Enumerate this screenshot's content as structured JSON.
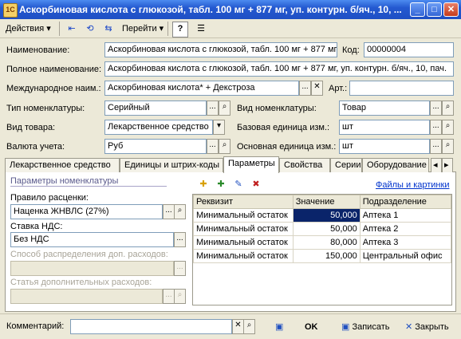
{
  "window": {
    "title": "Аскорбиновая кислота с глюкозой, табл. 100 мг + 877 мг, уп. контурн. б/яч., 10, ..."
  },
  "toolbar": {
    "actions_label": "Действия",
    "goto_label": "Перейти"
  },
  "form": {
    "name_label": "Наименование:",
    "name_value": "Аскорбиновая кислота с глюкозой, табл. 100 мг + 877 мг",
    "code_label": "Код:",
    "code_value": "00000004",
    "fullname_label": "Полное наименование:",
    "fullname_value": "Аскорбиновая кислота с глюкозой, табл. 100 мг + 877 мг, уп. контурн. б/яч., 10, пач.",
    "intl_label": "Международное наим.:",
    "intl_value": "Аскорбиновая кислота* + Декстроза",
    "art_label": "Арт.:",
    "art_value": "",
    "nom_type_label": "Тип номенклатуры:",
    "nom_type_value": "Серийный",
    "nom_kind_label": "Вид номенклатуры:",
    "nom_kind_value": "Товар",
    "goods_kind_label": "Вид товара:",
    "goods_kind_value": "Лекарственное средство",
    "base_unit_label": "Базовая единица изм.:",
    "base_unit_value": "шт",
    "currency_label": "Валюта учета:",
    "currency_value": "Руб",
    "main_unit_label": "Основная единица изм.:",
    "main_unit_value": "шт"
  },
  "tabs": [
    "Лекарственное средство",
    "Единицы и штрих-коды",
    "Параметры",
    "Свойства",
    "Серии",
    "Оборудование"
  ],
  "params": {
    "section_title": "Параметры номенклатуры",
    "pricing_rule_label": "Правило расценки:",
    "pricing_rule_value": "Наценка ЖНВЛС (27%)",
    "vat_label": "Ставка НДС:",
    "vat_value": "Без НДС",
    "distribution_label": "Способ распределения доп. расходов:",
    "distribution_value": "",
    "extra_cost_label": "Статья дополнительных расходов:",
    "extra_cost_value": "",
    "files_link": "Файлы и картинки"
  },
  "grid": {
    "headers": [
      "Реквизит",
      "Значение",
      "Подразделение"
    ],
    "rows": [
      {
        "attr": "Минимальный остаток",
        "value": "50,000",
        "dept": "Аптека 1"
      },
      {
        "attr": "Минимальный остаток",
        "value": "50,000",
        "dept": "Аптека 2"
      },
      {
        "attr": "Минимальный остаток",
        "value": "80,000",
        "dept": "Аптека 3"
      },
      {
        "attr": "Минимальный остаток",
        "value": "150,000",
        "dept": "Центральный офис"
      }
    ]
  },
  "footer": {
    "comment_label": "Комментарий:",
    "comment_value": "",
    "ok_label": "OK",
    "save_label": "Записать",
    "close_label": "Закрыть"
  }
}
